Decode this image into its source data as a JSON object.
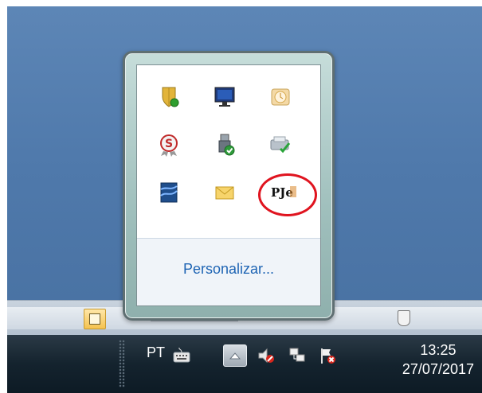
{
  "taskbar": {
    "language": "PT",
    "time": "13:25",
    "date": "27/07/2017",
    "icons": [
      "keyboard-icon",
      "show-hidden-icons-arrow",
      "volume-muted-icon",
      "network-icon",
      "action-center-flag-icon"
    ]
  },
  "flyout": {
    "customize_label": "Personalizar...",
    "icons": [
      {
        "name": "shield-security-icon"
      },
      {
        "name": "monitor-display-icon"
      },
      {
        "name": "calendar-clock-icon"
      },
      {
        "name": "s-badge-icon"
      },
      {
        "name": "usb-safely-remove-icon"
      },
      {
        "name": "printer-check-icon"
      },
      {
        "name": "app-blue-icon"
      },
      {
        "name": "mail-envelope-icon"
      },
      {
        "name": "pje-icon",
        "label": "PJe",
        "highlighted": true
      }
    ]
  },
  "colors": {
    "desktop": "#4f79ab",
    "taskbar": "#14232e",
    "link": "#1e64b4",
    "highlight": "#e0141f"
  }
}
